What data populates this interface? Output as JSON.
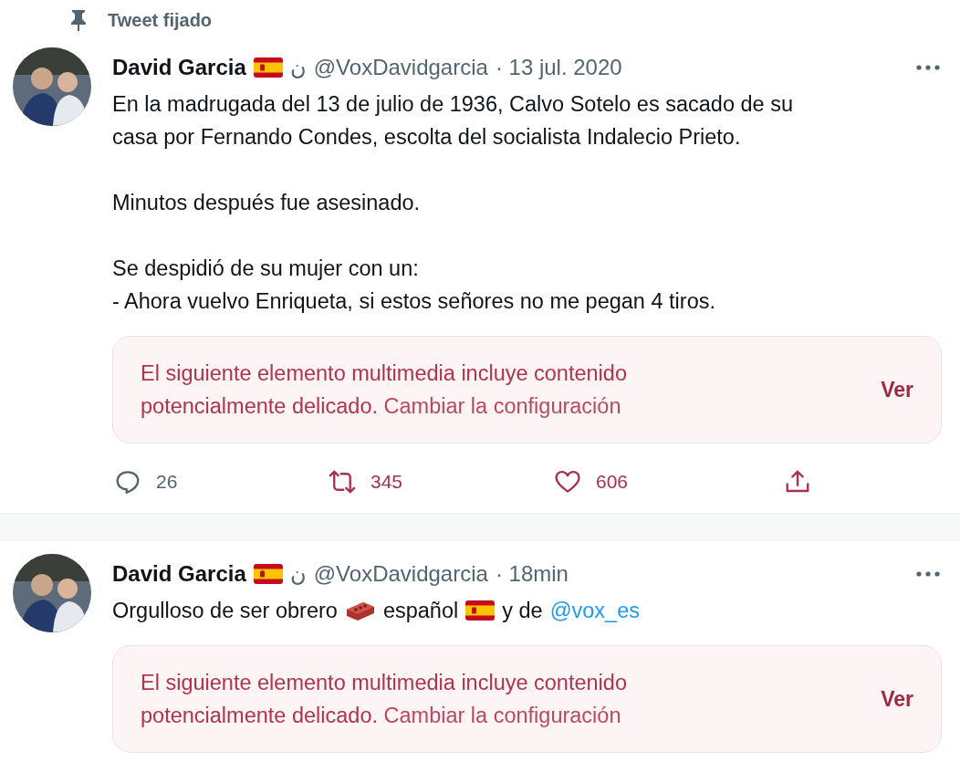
{
  "tweets": [
    {
      "pinned_label": "Tweet fijado",
      "name": "David Garcia",
      "name_suffix": "ن",
      "handle": "@VoxDavidgarcia",
      "time": "· 13 jul. 2020",
      "paragraphs": [
        [
          {
            "kind": "text",
            "text": "En la madrugada del 13 de julio de 1936, Calvo Sotelo es sacado de su\ncasa por Fernando Condes, escolta del socialista Indalecio Prieto."
          }
        ],
        [
          {
            "kind": "text",
            "text": "Minutos después fue asesinado."
          }
        ],
        [
          {
            "kind": "text",
            "text": "Se despidió de su mujer con un:\n- Ahora vuelvo Enriqueta, si estos señores no me pegan 4 tiros."
          }
        ]
      ],
      "sensitive": {
        "message": "El siguiente elemento multimedia incluye contenido\npotencialmente delicado.",
        "link": "Cambiar la configuración",
        "button": "Ver"
      },
      "actions": {
        "replies": "26",
        "retweets": "345",
        "likes": "606"
      }
    },
    {
      "name": "David Garcia",
      "name_suffix": "ن",
      "handle": "@VoxDavidgarcia",
      "time": "· 18min",
      "paragraphs": [
        [
          {
            "kind": "text",
            "text": "Orgulloso de ser obrero"
          },
          {
            "kind": "brick"
          },
          {
            "kind": "text",
            "text": "español"
          },
          {
            "kind": "flag"
          },
          {
            "kind": "text",
            "text": "y de"
          },
          {
            "kind": "mention",
            "text": "@vox_es"
          }
        ]
      ],
      "sensitive": {
        "message": "El siguiente elemento multimedia incluye contenido\npotencialmente delicado.",
        "link": "Cambiar la configuración",
        "button": "Ver"
      }
    }
  ]
}
